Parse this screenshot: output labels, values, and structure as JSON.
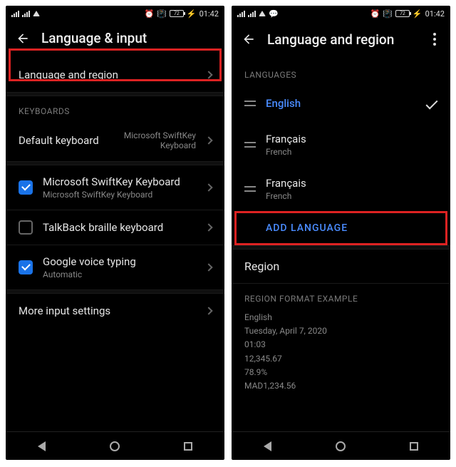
{
  "status": {
    "time": "01:42",
    "battery": "72"
  },
  "left": {
    "title": "Language & input",
    "lang_region": "Language and region",
    "keyboards_label": "KEYBOARDS",
    "default_label": "Default keyboard",
    "default_value_l1": "Microsoft SwiftKey",
    "default_value_l2": "Keyboard",
    "kb1_title": "Microsoft SwiftKey Keyboard",
    "kb1_sub": "Microsoft SwiftKey Keyboard",
    "kb2_title": "TalkBack braille keyboard",
    "kb3_title": "Google voice typing",
    "kb3_sub": "Automatic",
    "more": "More input settings"
  },
  "right": {
    "title": "Language and region",
    "languages_label": "LANGUAGES",
    "lang1": "English",
    "lang2_prim": "Français",
    "lang2_sec": "French",
    "lang3_prim": "Français",
    "lang3_sec": "French",
    "add": "ADD LANGUAGE",
    "region_header": "Region",
    "format_label": "REGION FORMAT EXAMPLE",
    "fmt_lang": "English",
    "fmt_date": "Tuesday, April 7, 2020",
    "fmt_time": "01:03",
    "fmt_num": "12,345.67",
    "fmt_pct": "78.9%",
    "fmt_curr": "MAD1,234.56"
  }
}
